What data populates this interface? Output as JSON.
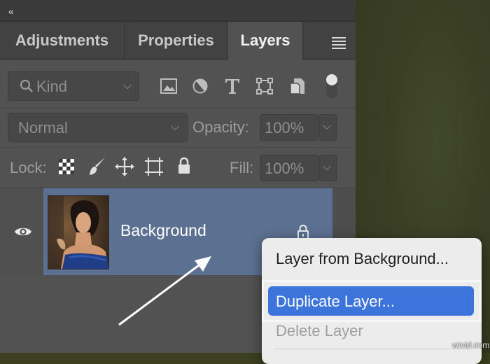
{
  "topbar": {
    "collapse_glyph": "«"
  },
  "tabs": [
    {
      "label": "Adjustments",
      "active": false
    },
    {
      "label": "Properties",
      "active": false
    },
    {
      "label": "Layers",
      "active": true
    }
  ],
  "filter": {
    "kind_label": "Kind",
    "icons": [
      "image-filter-icon",
      "adjustment-filter-icon",
      "type-filter-icon",
      "shape-filter-icon",
      "smart-object-filter-icon",
      "filter-toggle-icon"
    ]
  },
  "blend": {
    "mode": "Normal",
    "opacity_label": "Opacity:",
    "opacity_value": "100%"
  },
  "lock": {
    "label": "Lock:",
    "fill_label": "Fill:",
    "fill_value": "100%",
    "icons": [
      "lock-transparent-icon",
      "lock-image-icon",
      "lock-position-icon",
      "lock-artboard-icon",
      "lock-all-icon"
    ]
  },
  "layer": {
    "name": "Background",
    "visible": true,
    "locked": true,
    "selected_color": "#5c7191"
  },
  "context_menu": {
    "items": [
      {
        "label": "Layer from Background...",
        "state": "normal"
      },
      {
        "label": "Duplicate Layer...",
        "state": "highlighted"
      },
      {
        "label": "Delete Layer",
        "state": "disabled"
      }
    ],
    "highlight_color": "#3d74db"
  },
  "watermark": "wtvid.com"
}
